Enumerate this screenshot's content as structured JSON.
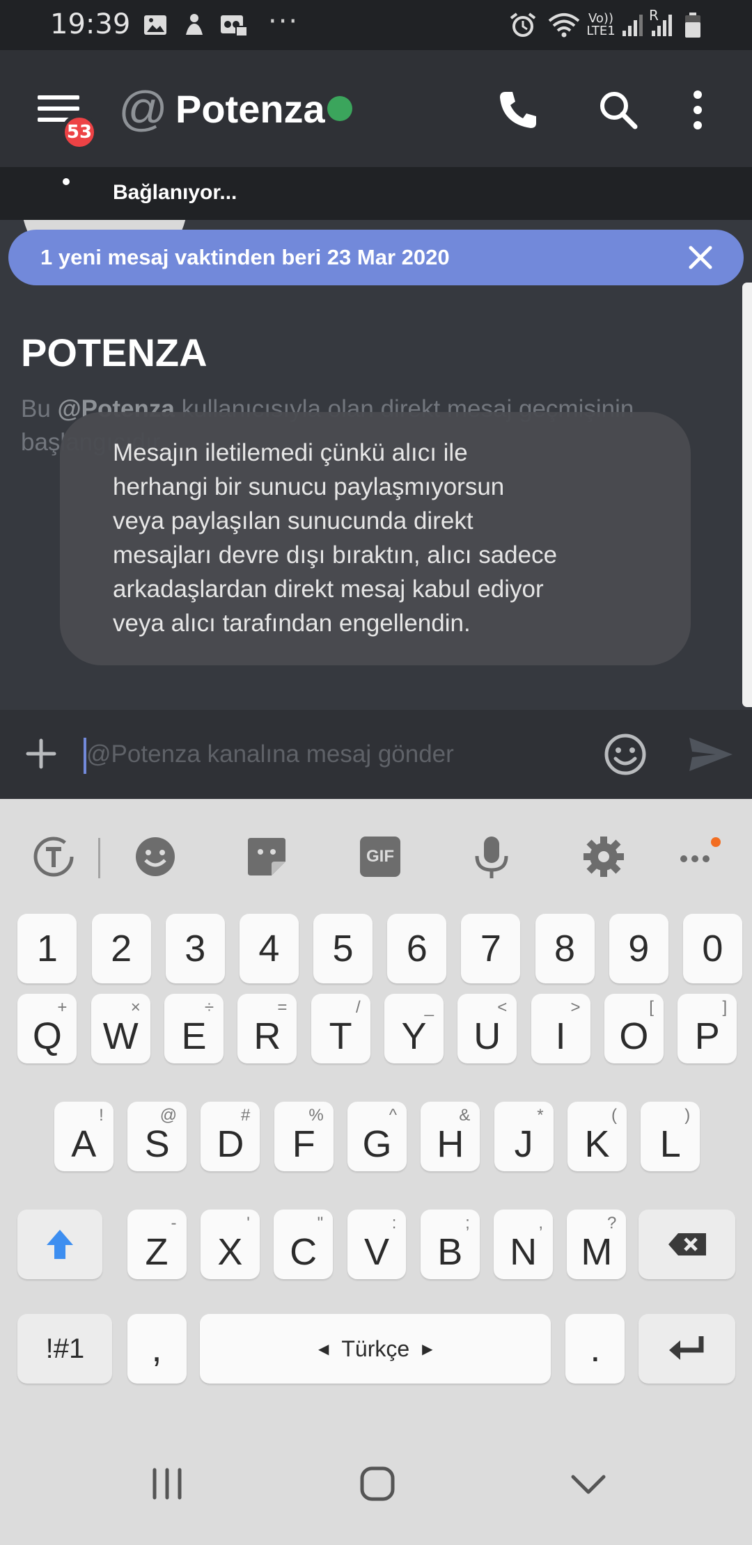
{
  "status_bar": {
    "time": "19:39",
    "icons": [
      "gallery-icon",
      "notification-icon",
      "voicemail-icon"
    ],
    "more": "···",
    "network_top": "Vo))",
    "network_bottom": "LTE1",
    "roaming": "R"
  },
  "header": {
    "at": "@",
    "title": "Potenza",
    "unread_badge": "53",
    "presence_color": "#3ba55c"
  },
  "connection": {
    "status": "Bağlanıyor..."
  },
  "banner": {
    "text": "1 yeni mesaj vaktinden beri 23 Mar 2020"
  },
  "chat": {
    "dm_title": "POTENZA",
    "intro_prefix": "Bu ",
    "intro_user": "@Potenza",
    "intro_suffix": " kullanıcısıyla olan direkt mesaj geçmişinin başlangıcıdır.",
    "toast_lines": [
      "Mesajın iletilemedi çünkü alıcı ile",
      "herhangi bir sunucu paylaşmıyorsun",
      "veya paylaşılan sunucunda direkt",
      "mesajları devre dışı bıraktın, alıcı sadece",
      "arkadaşlardan direkt mesaj kabul ediyor",
      "veya alıcı tarafından engellendin."
    ]
  },
  "composer": {
    "placeholder": "@Potenza kanalına mesaj gönder"
  },
  "keyboard": {
    "toolbar": [
      "translate-icon",
      "emoji-icon",
      "sticker-icon",
      "gif-icon",
      "mic-icon",
      "settings-icon",
      "more-icon"
    ],
    "gif_label": "GIF",
    "numbers": [
      "1",
      "2",
      "3",
      "4",
      "5",
      "6",
      "7",
      "8",
      "9",
      "0"
    ],
    "row1": [
      [
        "Q",
        "+"
      ],
      [
        "W",
        "×"
      ],
      [
        "E",
        "÷"
      ],
      [
        "R",
        "="
      ],
      [
        "T",
        "/"
      ],
      [
        "Y",
        "_"
      ],
      [
        "U",
        "<"
      ],
      [
        "I",
        ">"
      ],
      [
        "O",
        "["
      ],
      [
        "P",
        "]"
      ]
    ],
    "row2": [
      [
        "A",
        "!"
      ],
      [
        "S",
        "@"
      ],
      [
        "D",
        "#"
      ],
      [
        "F",
        "%"
      ],
      [
        "G",
        "^"
      ],
      [
        "H",
        "&"
      ],
      [
        "J",
        "*"
      ],
      [
        "K",
        "("
      ],
      [
        "L",
        ")"
      ]
    ],
    "row3": [
      [
        "Z",
        "-"
      ],
      [
        "X",
        "'"
      ],
      [
        "C",
        "\""
      ],
      [
        "V",
        ":"
      ],
      [
        "B",
        ";"
      ],
      [
        "N",
        ","
      ],
      [
        "M",
        "?"
      ]
    ],
    "symbols_label": "!#1",
    "comma": ",",
    "space_label": "Türkçe",
    "period": ".",
    "accent_color": "#3d8ef0"
  },
  "nav": [
    "recent-apps-icon",
    "home-icon",
    "back-icon"
  ]
}
